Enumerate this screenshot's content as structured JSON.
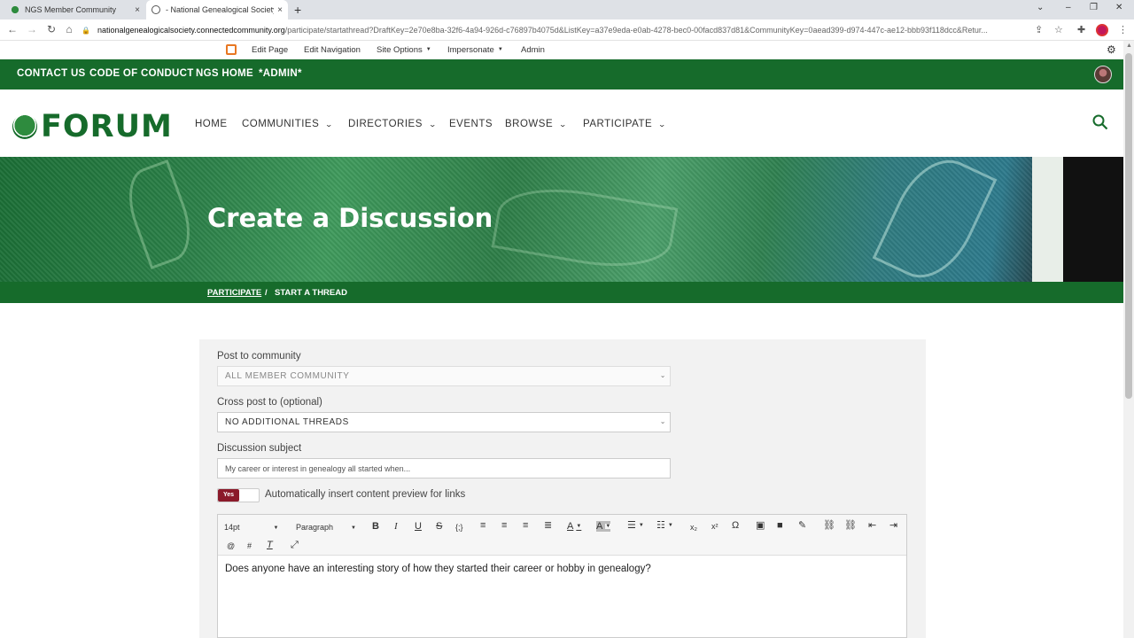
{
  "browser": {
    "tabs": [
      {
        "label": "NGS Member Community",
        "close": "×"
      },
      {
        "label": "- National Genealogical Society",
        "close": "×"
      }
    ],
    "new_tab": "+",
    "url_host": "nationalgenealogicalsociety.connectedcommunity.org",
    "url_path": "/participate/startathread?DraftKey=2e70e8ba-32f6-4a94-926d-c76897b4075d&ListKey=a37e9eda-e0ab-4278-bec0-00facd837d81&CommunityKey=0aead399-d974-447c-ae12-bbb93f118dcc&Retur..."
  },
  "admin_toolbar": {
    "edit_page": "Edit Page",
    "edit_navigation": "Edit Navigation",
    "site_options": "Site Options",
    "impersonate": "Impersonate",
    "admin": "Admin"
  },
  "top_nav": {
    "contact_us": "CONTACT US",
    "code_of_conduct": "CODE OF CONDUCT",
    "ngs_home": "NGS HOME",
    "admin": "*ADMIN*"
  },
  "logo": {
    "text": "FORUM"
  },
  "main_nav": {
    "home": "HOME",
    "communities": "COMMUNITIES",
    "directories": "DIRECTORIES",
    "events": "EVENTS",
    "browse": "BROWSE",
    "participate": "PARTICIPATE"
  },
  "hero": {
    "title": "Create a Discussion"
  },
  "breadcrumb": {
    "parent": "PARTICIPATE",
    "separator": "/",
    "current": "START A THREAD"
  },
  "form": {
    "post_to_label": "Post to community",
    "post_to_value": "ALL MEMBER COMMUNITY",
    "cross_post_label": "Cross post to (optional)",
    "cross_post_value": "NO ADDITIONAL THREADS",
    "subject_label": "Discussion subject",
    "subject_value": "My career or interest in genealogy all started when...",
    "toggle_state": "Yes",
    "toggle_label": "Automatically insert content preview for links"
  },
  "editor": {
    "font_size": "14pt",
    "block_format": "Paragraph",
    "body": "Does anyone have an interesting story of how they started their career or hobby in genealogy?"
  },
  "colors": {
    "brand_green": "#166b2b",
    "toggle_red": "#8b1a2a"
  }
}
